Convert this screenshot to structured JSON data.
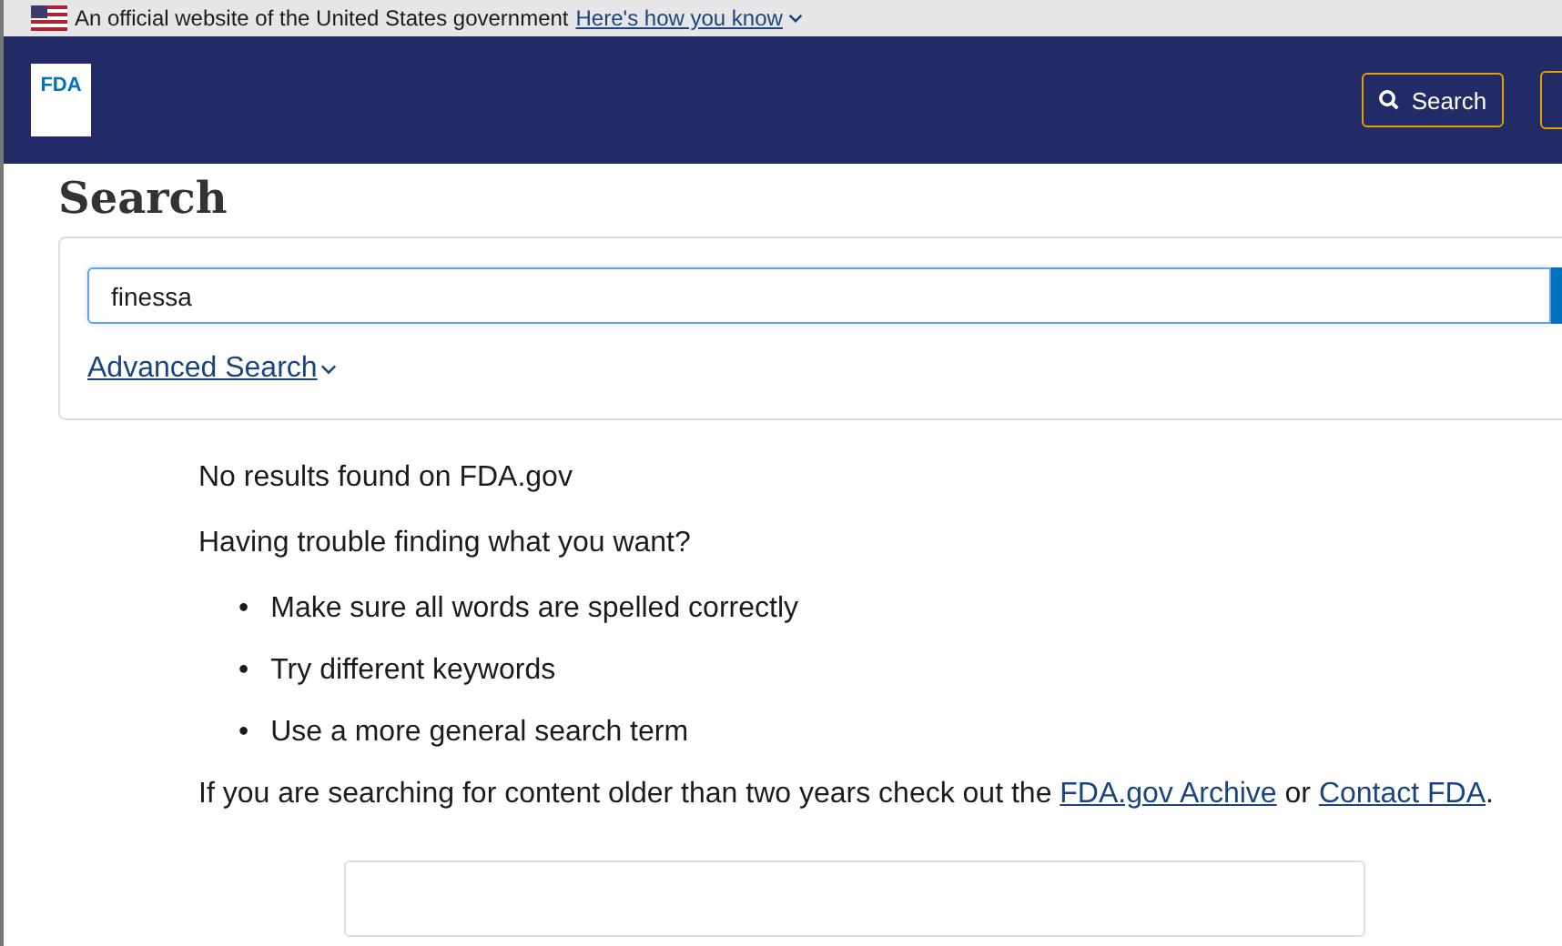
{
  "gov_banner": {
    "text": "An official website of the United States government",
    "link": "Here's how you know"
  },
  "header": {
    "logo": "FDA",
    "search_button": "Search"
  },
  "page": {
    "title": "Search",
    "search": {
      "value": "finessa"
    },
    "advanced_link": "Advanced Search"
  },
  "results": {
    "message": "No results found on FDA.gov",
    "help_heading": "Having trouble finding what you want?",
    "tips": [
      {
        "marker": "•",
        "text": "Make sure all words are spelled correctly"
      },
      {
        "marker": "•",
        "text": "Try different keywords"
      },
      {
        "marker": "•",
        "text": "Use a more general search term"
      }
    ],
    "footer_parts": [
      {
        "kind": "text",
        "text": "If you are searching for content older than two years check out the "
      },
      {
        "kind": "link",
        "text": "FDA.gov Archive"
      },
      {
        "kind": "text",
        "text": " or "
      },
      {
        "kind": "link",
        "text": "Contact FDA"
      },
      {
        "kind": "text",
        "text": "."
      }
    ]
  }
}
